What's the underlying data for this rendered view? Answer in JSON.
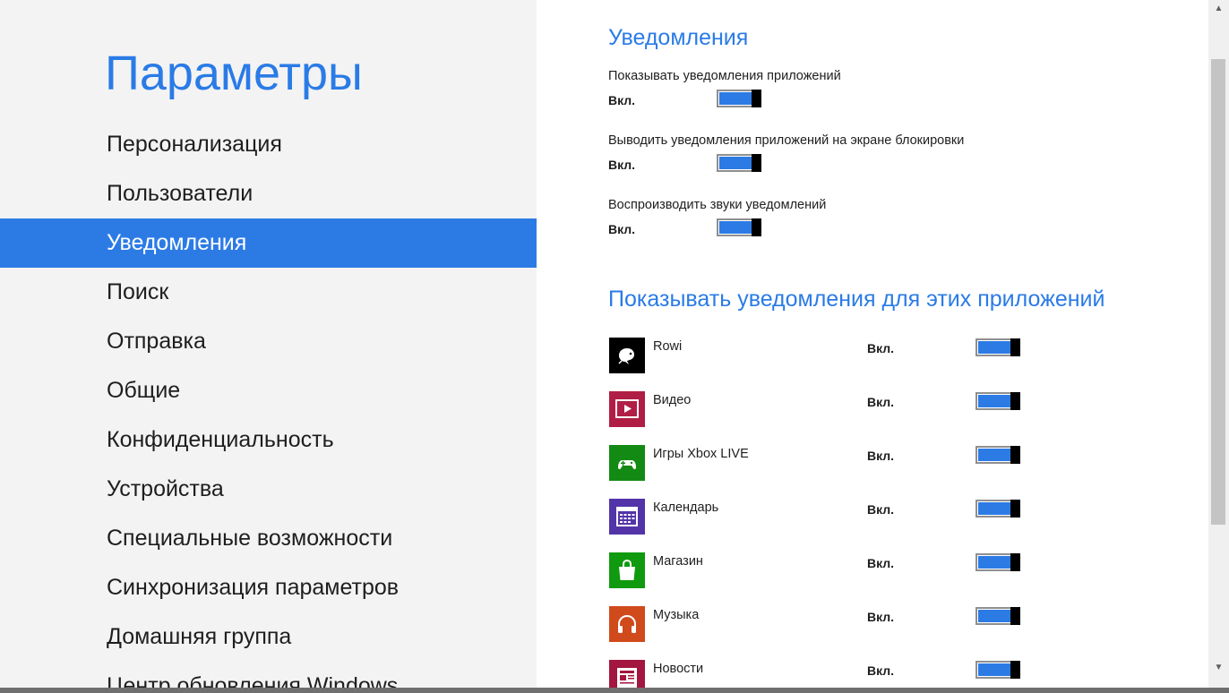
{
  "sidebar": {
    "title": "Параметры",
    "items": [
      {
        "label": "Персонализация",
        "selected": false
      },
      {
        "label": "Пользователи",
        "selected": false
      },
      {
        "label": "Уведомления",
        "selected": true
      },
      {
        "label": "Поиск",
        "selected": false
      },
      {
        "label": "Отправка",
        "selected": false
      },
      {
        "label": "Общие",
        "selected": false
      },
      {
        "label": "Конфиденциальность",
        "selected": false
      },
      {
        "label": "Устройства",
        "selected": false
      },
      {
        "label": "Специальные возможности",
        "selected": false
      },
      {
        "label": "Синхронизация параметров",
        "selected": false
      },
      {
        "label": "Домашняя группа",
        "selected": false
      },
      {
        "label": "Центр обновления Windows",
        "selected": false
      }
    ]
  },
  "notifications": {
    "title": "Уведомления",
    "settings": [
      {
        "label": "Показывать уведомления приложений",
        "state": "Вкл.",
        "on": true
      },
      {
        "label": "Выводить уведомления приложений на экране блокировки",
        "state": "Вкл.",
        "on": true
      },
      {
        "label": "Воспроизводить звуки уведомлений",
        "state": "Вкл.",
        "on": true
      }
    ]
  },
  "apps": {
    "title": "Показывать уведомления для этих приложений",
    "list": [
      {
        "name": "Rowi",
        "state": "Вкл.",
        "on": true,
        "icon": "rowi-bird-icon",
        "color": "#000000"
      },
      {
        "name": "Видео",
        "state": "Вкл.",
        "on": true,
        "icon": "video-icon",
        "color": "#b01e45"
      },
      {
        "name": "Игры Xbox LIVE",
        "state": "Вкл.",
        "on": true,
        "icon": "gamepad-icon",
        "color": "#138a13"
      },
      {
        "name": "Календарь",
        "state": "Вкл.",
        "on": true,
        "icon": "calendar-icon",
        "color": "#5234a8"
      },
      {
        "name": "Магазин",
        "state": "Вкл.",
        "on": true,
        "icon": "shopping-bag-icon",
        "color": "#0f9a0f"
      },
      {
        "name": "Музыка",
        "state": "Вкл.",
        "on": true,
        "icon": "headphones-icon",
        "color": "#d04a1c"
      },
      {
        "name": "Новости",
        "state": "Вкл.",
        "on": true,
        "icon": "news-icon",
        "color": "#a3163f"
      }
    ]
  },
  "colors": {
    "accent": "#2c7be5",
    "sidebar_bg": "#f3f3f3",
    "heading": "#2a7be6",
    "knob": "#000000"
  }
}
